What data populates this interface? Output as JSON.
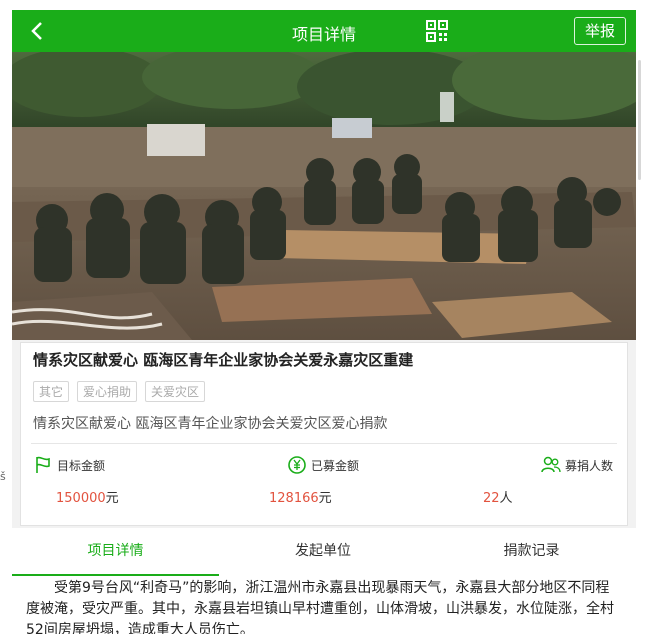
{
  "topbar": {
    "title": "项目详情",
    "report_label": "举报"
  },
  "project": {
    "title": "情系灾区献爱心 瓯海区青年企业家协会关爱永嘉灾区重建",
    "tags": [
      "其它",
      "爱心捐助",
      "关爱灾区"
    ],
    "description": "情系灾区献爱心 瓯海区青年企业家协会关爱灾区爱心捐款"
  },
  "stats": {
    "target_label": "目标金额",
    "target_value": "150000",
    "target_unit": "元",
    "raised_label": "已募金额",
    "raised_value": "128166",
    "raised_unit": "元",
    "donors_label": "募捐人数",
    "donors_value": "22",
    "donors_unit": "人"
  },
  "tabs": [
    "项目详情",
    "发起单位",
    "捐款记录"
  ],
  "content_text": "受第9号台风“利奇马”的影响，浙江温州市永嘉县出现暴雨天气，永嘉县大部分地区不同程度被淹，受灾严重。其中，永嘉县岩坦镇山早村遭重创，山体滑坡，山洪暴发，水位陡涨，全村52间房屋坍塌，造成重大人员伤亡。",
  "left_fragment": "š",
  "colors": {
    "accent": "#1aad19",
    "amount": "#e2533f"
  }
}
